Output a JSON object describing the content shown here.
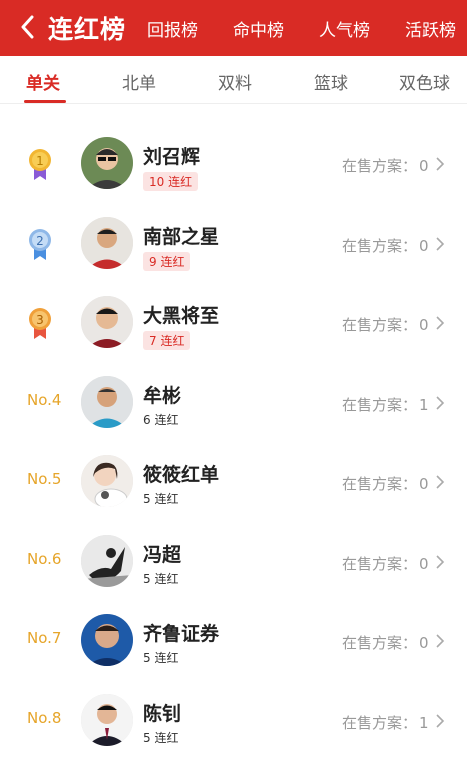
{
  "header": {
    "title": "连红榜",
    "nav": [
      "回报榜",
      "命中榜",
      "人气榜",
      "活跃榜"
    ]
  },
  "tabs": [
    "单关",
    "北单",
    "双料",
    "篮球",
    "双色球"
  ],
  "sale_label": "在售方案：",
  "rows": [
    {
      "rank": "1",
      "name": "刘召辉",
      "streak": "10 连红",
      "sale": "0"
    },
    {
      "rank": "2",
      "name": "南部之星",
      "streak": "9 连红",
      "sale": "0"
    },
    {
      "rank": "3",
      "name": "大黑将至",
      "streak": "7 连红",
      "sale": "0"
    },
    {
      "rank": "No.4",
      "name": "牟彬",
      "streak": "6 连红",
      "sale": "1"
    },
    {
      "rank": "No.5",
      "name": "筱筱红单",
      "streak": "5 连红",
      "sale": "0"
    },
    {
      "rank": "No.6",
      "name": "冯超",
      "streak": "5 连红",
      "sale": "0"
    },
    {
      "rank": "No.7",
      "name": "齐鲁证券",
      "streak": "5 连红",
      "sale": "0"
    },
    {
      "rank": "No.8",
      "name": "陈钊",
      "streak": "5 连红",
      "sale": "1"
    }
  ],
  "colors": {
    "brand": "#d92b25",
    "gold": "#f2b632",
    "silver": "#8fb8e8",
    "bronze": "#f0a03a"
  }
}
